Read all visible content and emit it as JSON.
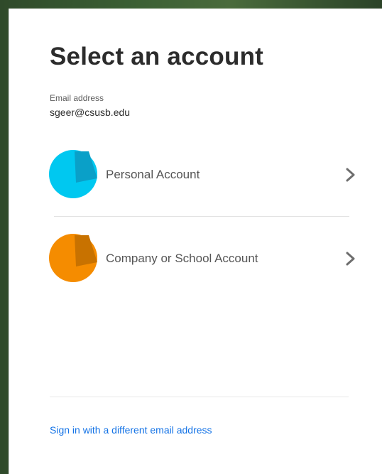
{
  "header": {
    "title": "Select an account"
  },
  "email": {
    "label": "Email address",
    "value": "sgeer@csusb.edu"
  },
  "accounts": [
    {
      "label": "Personal Account",
      "icon": "personal-account-avatar-icon",
      "color": "#00c8f0",
      "accent": "#0aa0c8"
    },
    {
      "label": "Company or School Account",
      "icon": "company-account-avatar-icon",
      "color": "#f58c00",
      "accent": "#c87200"
    }
  ],
  "footer": {
    "link_label": "Sign in with a different email address",
    "link_color": "#1473e6"
  }
}
